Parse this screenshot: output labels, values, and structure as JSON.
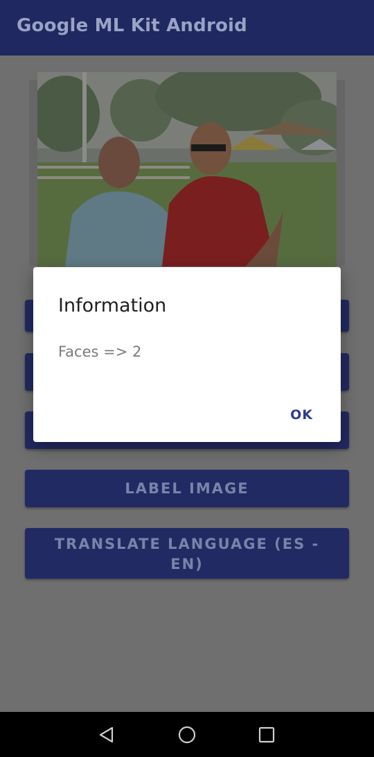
{
  "app_bar": {
    "title": "Google ML Kit Android"
  },
  "main": {
    "buttons": [
      {
        "label": ""
      },
      {
        "label": ""
      },
      {
        "label": ""
      },
      {
        "label": "LABEL IMAGE"
      },
      {
        "label_line1": "TRANSLATE LANGUAGE (ES -",
        "label_line2": "EN)"
      }
    ]
  },
  "dialog": {
    "title": "Information",
    "message": "Faces => 2",
    "ok_label": "OK"
  },
  "nav": {
    "back_icon": "back-triangle-icon",
    "home_icon": "home-circle-icon",
    "recents_icon": "recents-square-icon"
  },
  "colors": {
    "app_bar": "#1f2860",
    "button_bg": "#222a63",
    "dialog_accent": "#2f3a8f",
    "scrim": "#6f6f6f"
  }
}
